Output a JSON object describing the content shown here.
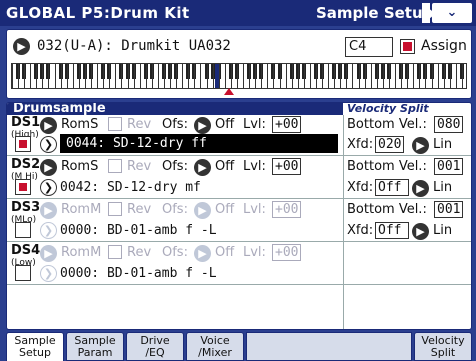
{
  "title": {
    "page": "GLOBAL  P5:Drum Kit",
    "section": "Sample Setup",
    "menu_icon": "chevron-down-icon"
  },
  "kit": {
    "name": "032(U-A): Drumkit  UA032",
    "key": "C4",
    "assign_label": "Assign",
    "assign_checked": true
  },
  "drumsample_header": "Drumsample",
  "velocity_split_header": "Velocity Split",
  "rows": [
    {
      "label": "DS1",
      "sub": "(High)",
      "bank": "RomS",
      "rev_label": "Rev",
      "ofs_label": "Ofs:",
      "ofs_value": "Off",
      "lvl_label": "Lvl:",
      "lvl_value": "+00",
      "sample": "0044: SD-12-dry ff",
      "on": true,
      "enabled": true,
      "bottom_vel_label": "Bottom Vel.:",
      "bottom_vel": "080",
      "xfd_label": "Xfd:",
      "xfd": "020",
      "curve": "Lin",
      "selected": true
    },
    {
      "label": "DS2",
      "sub": "(M Hi)",
      "bank": "RomS",
      "rev_label": "Rev",
      "ofs_label": "Ofs:",
      "ofs_value": "Off",
      "lvl_label": "Lvl:",
      "lvl_value": "+00",
      "sample": "0042: SD-12-dry mf",
      "on": true,
      "enabled": true,
      "bottom_vel_label": "Bottom Vel.:",
      "bottom_vel": "001",
      "xfd_label": "Xfd:",
      "xfd": "Off",
      "curve": "Lin",
      "selected": false
    },
    {
      "label": "DS3",
      "sub": "(MLo)",
      "bank": "RomM",
      "rev_label": "Rev",
      "ofs_label": "Ofs:",
      "ofs_value": "Off",
      "lvl_label": "Lvl:",
      "lvl_value": "+00",
      "sample": "0000: BD-01-amb f -L",
      "on": false,
      "enabled": false,
      "bottom_vel_label": "Bottom Vel.:",
      "bottom_vel": "001",
      "xfd_label": "Xfd:",
      "xfd": "Off",
      "curve": "Lin",
      "selected": false
    },
    {
      "label": "DS4",
      "sub": "(Low)",
      "bank": "RomM",
      "rev_label": "Rev",
      "ofs_label": "Ofs:",
      "ofs_value": "Off",
      "lvl_label": "Lvl:",
      "lvl_value": "+00",
      "sample": "0000: BD-01-amb f -L",
      "on": false,
      "enabled": false,
      "selected": false
    }
  ],
  "tabs": [
    {
      "line1": "Sample",
      "line2": "Setup",
      "active": true
    },
    {
      "line1": "Sample",
      "line2": "Param",
      "active": false
    },
    {
      "line1": "Drive",
      "line2": "/EQ",
      "active": false
    },
    {
      "line1": "Voice",
      "line2": "/Mixer",
      "active": false
    },
    {
      "line1": "Velocity",
      "line2": "Split",
      "active": false
    }
  ]
}
